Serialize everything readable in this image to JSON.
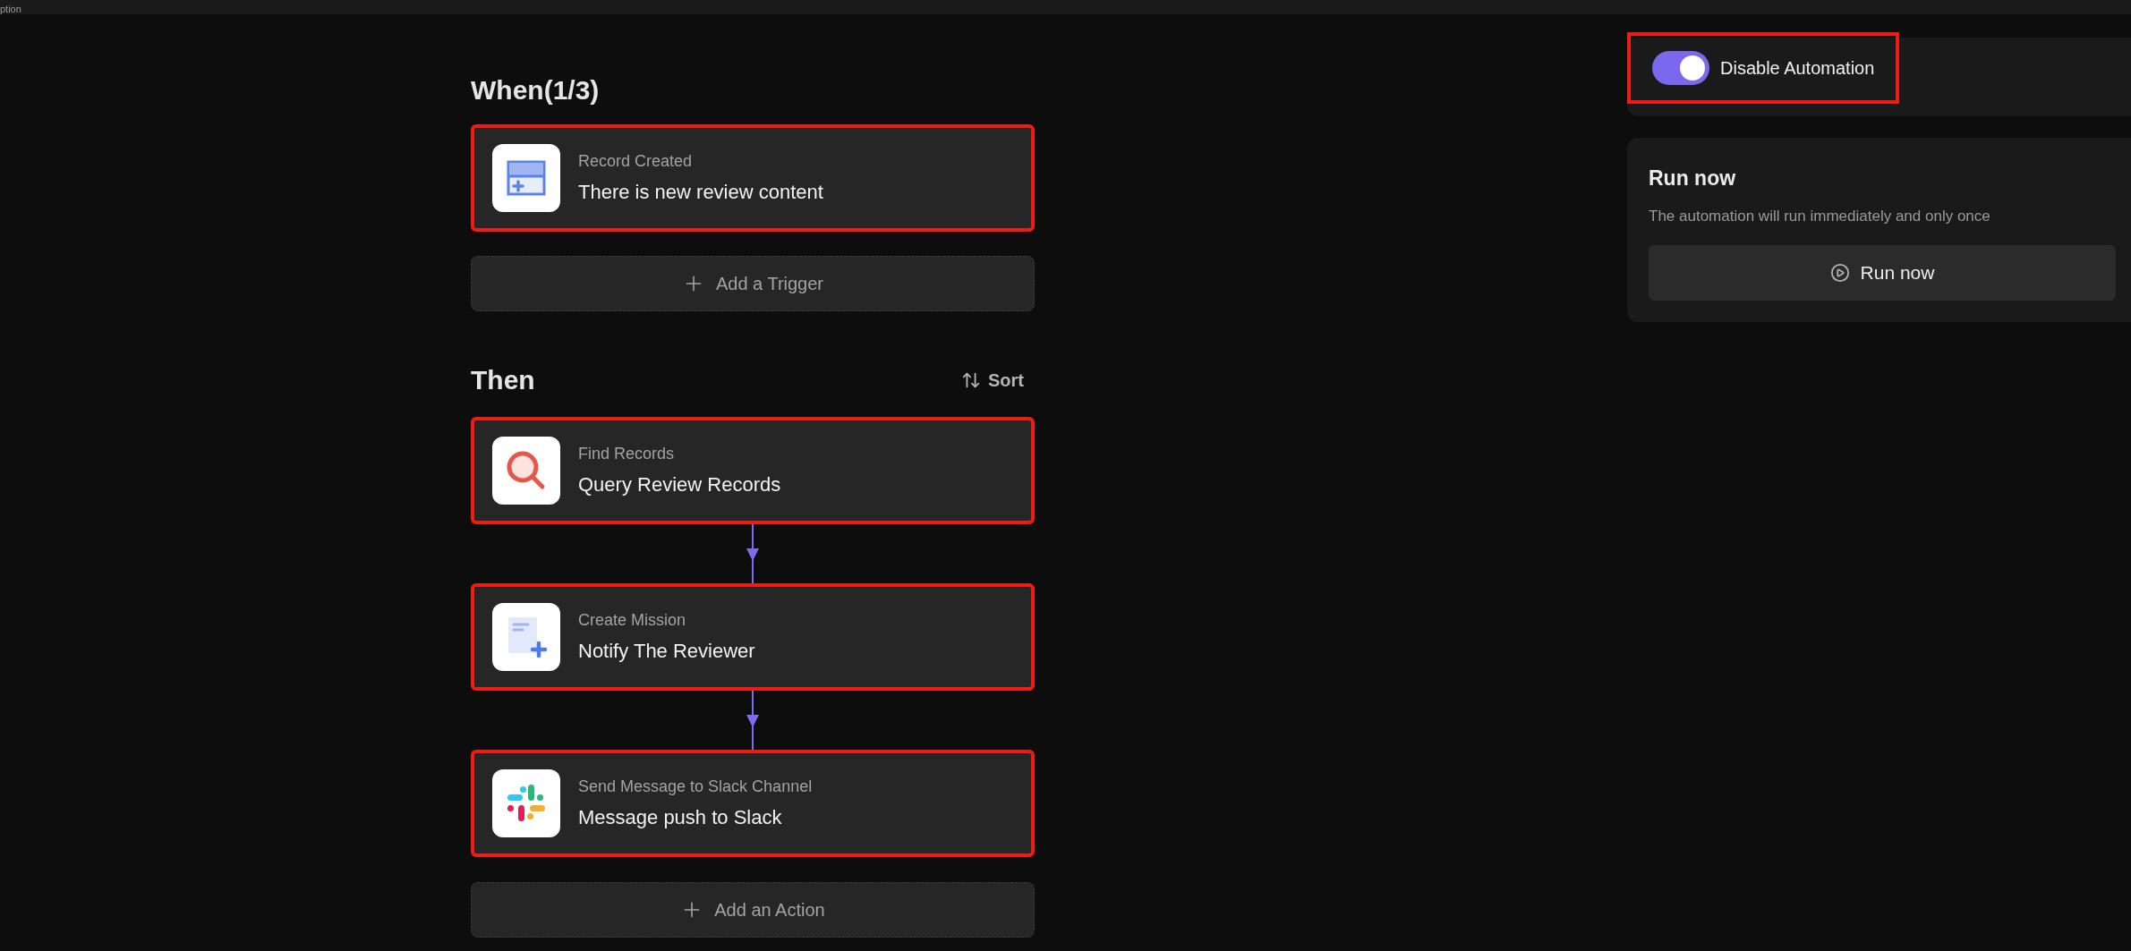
{
  "top_bar": {
    "text": "ption"
  },
  "when": {
    "heading": "When(1/3)",
    "triggers": [
      {
        "kind": "record_created",
        "title": "Record Created",
        "name": "There is new review content",
        "highlighted": true
      }
    ],
    "add_label": "Add a Trigger"
  },
  "then": {
    "heading": "Then",
    "sort_label": "Sort",
    "actions": [
      {
        "kind": "find_records",
        "title": "Find Records",
        "name": "Query Review Records",
        "highlighted": true
      },
      {
        "kind": "create_mission",
        "title": "Create Mission",
        "name": "Notify The Reviewer",
        "highlighted": true
      },
      {
        "kind": "slack_message",
        "title": "Send Message to Slack Channel",
        "name": "Message push to Slack",
        "highlighted": true
      }
    ],
    "add_label": "Add an Action"
  },
  "automation_toggle": {
    "label": "Disable Automation",
    "on": true,
    "highlighted": true
  },
  "run_now": {
    "title": "Run now",
    "description": "The automation will run immediately and only once",
    "button": "Run now"
  }
}
